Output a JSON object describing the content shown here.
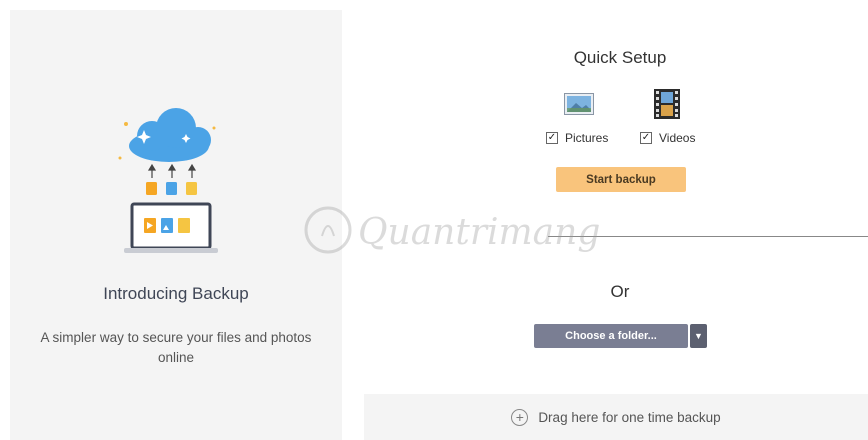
{
  "intro": {
    "title": "Introducing Backup",
    "subtitle": "A simpler way to secure your files and photos online"
  },
  "quick_setup": {
    "title": "Quick Setup",
    "options": [
      {
        "label": "Pictures",
        "checked": true,
        "icon": "pictures-icon"
      },
      {
        "label": "Videos",
        "checked": true,
        "icon": "videos-icon"
      }
    ],
    "start_button": "Start backup"
  },
  "or_text": "Or",
  "folder": {
    "choose_label": "Choose a folder...",
    "dropdown_icon": "caret-down-icon"
  },
  "drop_zone": {
    "label": "Drag here for one time backup",
    "icon": "plus-circle-icon"
  },
  "watermark": {
    "text": "Quantrimang"
  },
  "colors": {
    "start_button": "#f9c47c",
    "folder_button": "#7a7e93",
    "cloud": "#4ba3e6",
    "panel_bg": "#f4f4f4"
  }
}
